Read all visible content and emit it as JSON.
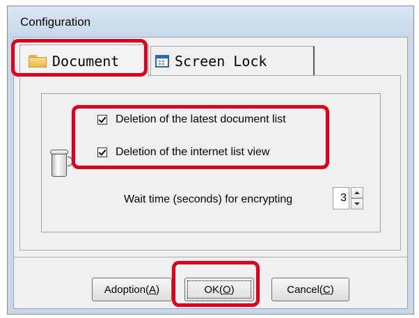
{
  "window": {
    "title": "Configuration"
  },
  "tabs": [
    {
      "label": "Document",
      "icon": "folder-icon",
      "selected": true
    },
    {
      "label": "Screen Lock",
      "icon": "window-icon",
      "selected": false
    }
  ],
  "document_tab": {
    "options": [
      {
        "label": "Deletion of the latest document list",
        "checked": true
      },
      {
        "label": "Deletion of the internet list view",
        "checked": true
      }
    ],
    "wait_time": {
      "label": "Wait time (seconds) for encrypting",
      "value": "3"
    }
  },
  "buttons": {
    "adoption": {
      "prefix": "Adoption(",
      "accel": "A",
      "suffix": ")"
    },
    "ok": {
      "prefix": "OK(",
      "accel": "O",
      "suffix": ")"
    },
    "cancel": {
      "prefix": "Cancel(",
      "accel": "C",
      "suffix": ")"
    }
  },
  "colors": {
    "highlight": "#e0001b",
    "title_bar": "#c8d8ea",
    "dialog_bg": "#f0f0f0"
  }
}
